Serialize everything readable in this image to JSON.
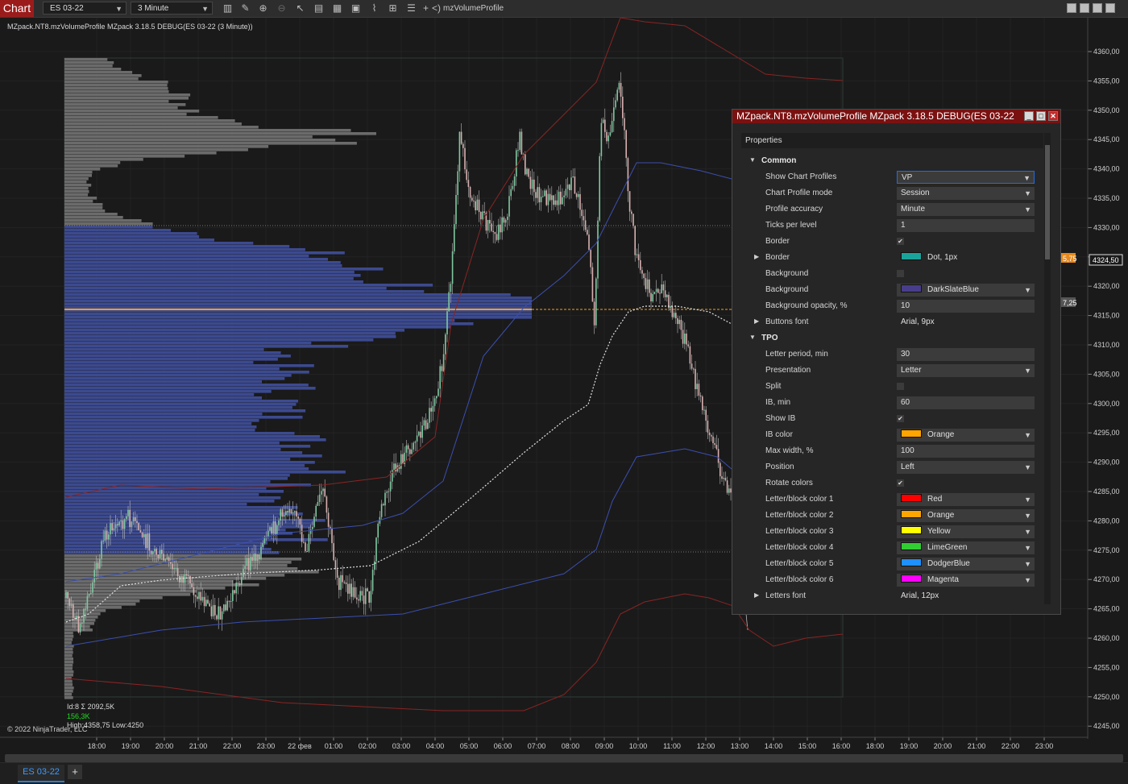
{
  "toolbar": {
    "chart_tab": "Chart",
    "instrument": "ES 03-22",
    "interval": "3 Minute",
    "indicator_name": "mzVolumeProfile",
    "icons": [
      "bars-icon",
      "draw-pen-icon",
      "zoom-in-icon",
      "zoom-out-icon",
      "pointer-icon",
      "properties-icon",
      "templates-icon",
      "strategy-icon",
      "indicators-icon",
      "data-box-icon",
      "list-icon"
    ]
  },
  "chart": {
    "indicator_label": "MZpack.NT8.mzVolumeProfile MZpack 3.18.5 DEBUG(ES 03-22 (3 Minute))",
    "price_labels": [
      "4360,00",
      "4355,00",
      "4350,00",
      "4345,00",
      "4340,00",
      "4335,00",
      "4330,00",
      "4325,00",
      "4320,00",
      "4315,00",
      "4310,00",
      "4305,00",
      "4300,00",
      "4295,00",
      "4290,00",
      "4285,00",
      "4280,00",
      "4275,00",
      "4270,00",
      "4265,00",
      "4260,00",
      "4255,00",
      "4250,00",
      "4245,00"
    ],
    "current_price_marker": "4324,50",
    "marker_a": "5,75",
    "marker_b": "7,25",
    "time_labels": [
      "18:00",
      "19:00",
      "20:00",
      "21:00",
      "22:00",
      "23:00",
      "22 фев",
      "01:00",
      "02:00",
      "03:00",
      "04:00",
      "05:00",
      "06:00",
      "07:00",
      "08:00",
      "09:00",
      "10:00",
      "11:00",
      "12:00",
      "13:00",
      "14:00",
      "15:00",
      "16:00",
      "18:00",
      "19:00",
      "20:00",
      "21:00",
      "22:00",
      "23:00"
    ],
    "stats_id": "Id:8 Σ 2092,5K",
    "stats_delta": "156,3K",
    "stats_range": "High:4358,75 Low:4250",
    "copyright": "© 2022 NinjaTrader, LLC",
    "colors": {
      "profile_gray": "#6b6b6b",
      "profile_blue": "#3c4a8f",
      "poc": "#f0a020",
      "up_candle": "#7ec8a0",
      "down_candle": "#d8b0b0",
      "vwap": "#e0e0e0",
      "band_blue": "#3b4fb0",
      "band_red": "#8a2424"
    }
  },
  "tabs": {
    "active": "ES 03-22",
    "add": "+"
  },
  "props": {
    "title": "MZpack.NT8.mzVolumeProfile MZpack 3.18.5 DEBUG(ES 03-22",
    "header": "Properties",
    "rows": [
      {
        "type": "section",
        "label": "Common"
      },
      {
        "label": "Show Chart Profiles",
        "value": "VP",
        "kind": "dropdown",
        "selected": true
      },
      {
        "label": "Chart Profile mode",
        "value": "Session",
        "kind": "dropdown"
      },
      {
        "label": "Profile accuracy",
        "value": "Minute",
        "kind": "dropdown"
      },
      {
        "label": "Ticks per level",
        "value": "1",
        "kind": "text"
      },
      {
        "label": "Border",
        "value": "✔",
        "kind": "check"
      },
      {
        "label": "Border",
        "value": "Dot, 1px",
        "kind": "plain",
        "swatch": "#1aa39a",
        "expandable": true
      },
      {
        "label": "Background",
        "value": "",
        "kind": "check"
      },
      {
        "label": "Background",
        "value": "DarkSlateBlue",
        "kind": "dropdown",
        "swatch": "#483d8b"
      },
      {
        "label": "Background opacity, %",
        "value": "10",
        "kind": "text"
      },
      {
        "label": "Buttons font",
        "value": "Arial, 9px",
        "kind": "plain",
        "expandable": true
      },
      {
        "type": "section",
        "label": "TPO"
      },
      {
        "label": "Letter period, min",
        "value": "30",
        "kind": "text"
      },
      {
        "label": "Presentation",
        "value": "Letter",
        "kind": "dropdown"
      },
      {
        "label": "Split",
        "value": "",
        "kind": "check"
      },
      {
        "label": "IB, min",
        "value": "60",
        "kind": "text"
      },
      {
        "label": "Show IB",
        "value": "✔",
        "kind": "check"
      },
      {
        "label": "IB color",
        "value": "Orange",
        "kind": "dropdown",
        "swatch": "#ffa500"
      },
      {
        "label": "Max width, %",
        "value": "100",
        "kind": "text"
      },
      {
        "label": "Position",
        "value": "Left",
        "kind": "dropdown"
      },
      {
        "label": "Rotate colors",
        "value": "✔",
        "kind": "check"
      },
      {
        "label": "Letter/block color 1",
        "value": "Red",
        "kind": "dropdown",
        "swatch": "#ff0000"
      },
      {
        "label": "Letter/block color 2",
        "value": "Orange",
        "kind": "dropdown",
        "swatch": "#ffa500"
      },
      {
        "label": "Letter/block color 3",
        "value": "Yellow",
        "kind": "dropdown",
        "swatch": "#ffff00"
      },
      {
        "label": "Letter/block color 4",
        "value": "LimeGreen",
        "kind": "dropdown",
        "swatch": "#32cd32"
      },
      {
        "label": "Letter/block color 5",
        "value": "DodgerBlue",
        "kind": "dropdown",
        "swatch": "#1e90ff"
      },
      {
        "label": "Letter/block color 6",
        "value": "Magenta",
        "kind": "dropdown",
        "swatch": "#ff00ff"
      },
      {
        "label": "Letters font",
        "value": "Arial, 12px",
        "kind": "plain",
        "expandable": true
      }
    ]
  }
}
